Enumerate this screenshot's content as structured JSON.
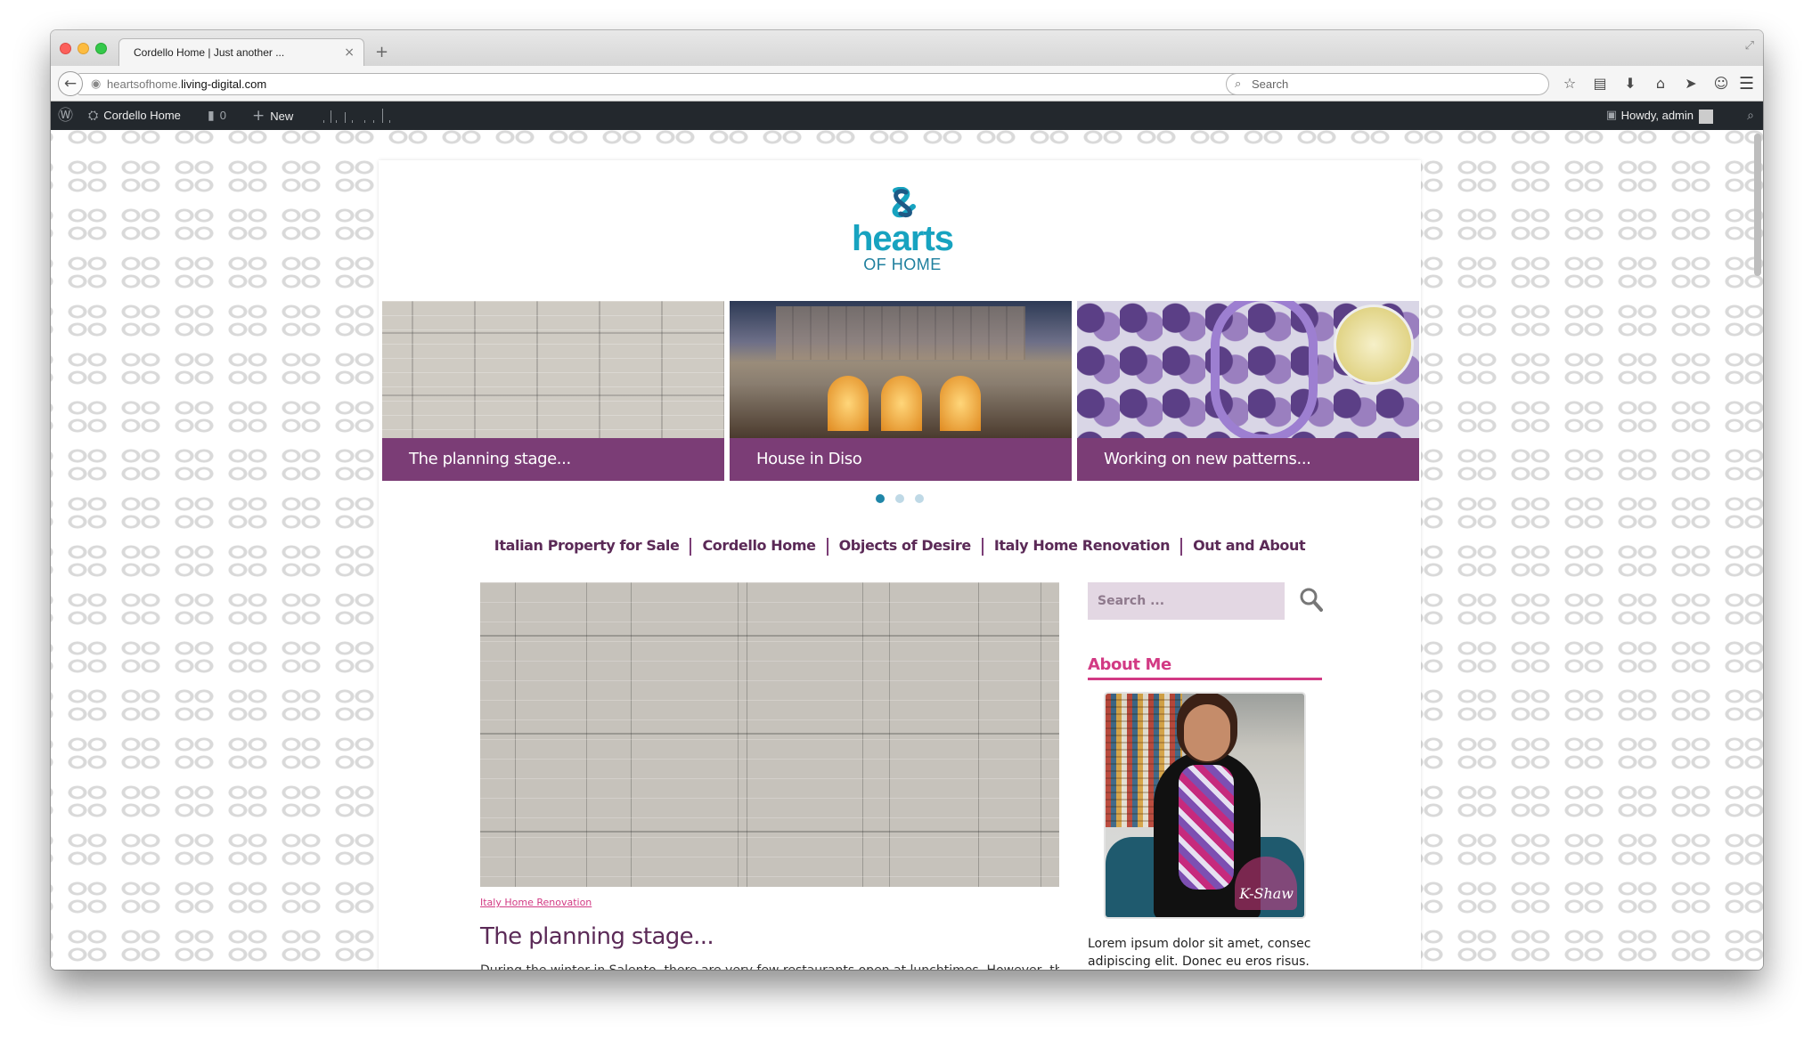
{
  "browser": {
    "tab_title": "Cordello Home | Just another ...",
    "tab_close": "×",
    "new_tab": "+",
    "url_prefix": "heartsofhome.",
    "url_host": "living-digital.com",
    "search_placeholder": "Search",
    "toolbar_icons": [
      "star-icon",
      "reading-list-icon",
      "download-icon",
      "home-icon",
      "send-icon",
      "chat-icon"
    ],
    "toolbar_glyphs": [
      "☆",
      "▤",
      "⬇",
      "⌂",
      "➤",
      "☺"
    ]
  },
  "adminbar": {
    "site_name": "Cordello Home",
    "comments_count": "0",
    "new_label": "New",
    "howdy": "Howdy, admin"
  },
  "site": {
    "logo_main": "hearts",
    "logo_sub": "OF HOME",
    "slides": [
      {
        "caption": "The planning stage..."
      },
      {
        "caption": "House in Diso"
      },
      {
        "caption": "Working on new patterns..."
      }
    ],
    "slider_active_index": 0,
    "nav": [
      "Italian Property for Sale",
      "Cordello Home",
      "Objects of Desire",
      "Italy Home Renovation",
      "Out and About"
    ],
    "post": {
      "category": "Italy Home Renovation",
      "title": "The planning stage...",
      "excerpt": "During the winter in Salento, there are very few restaurants open at lunchtimes. However, the lovely"
    },
    "sidebar": {
      "search_placeholder": "Search ...",
      "about_title": "About Me",
      "signature": "K-Shaw",
      "about_text": "Lorem ipsum dolor sit amet, consec adipiscing elit. Donec eu eros risus."
    }
  },
  "colors": {
    "brand_purple": "#7b3d76",
    "nav_purple": "#5b2a57",
    "accent_pink": "#d23a84",
    "logo_teal": "#17a3c0",
    "adminbar_bg": "#23282d"
  }
}
